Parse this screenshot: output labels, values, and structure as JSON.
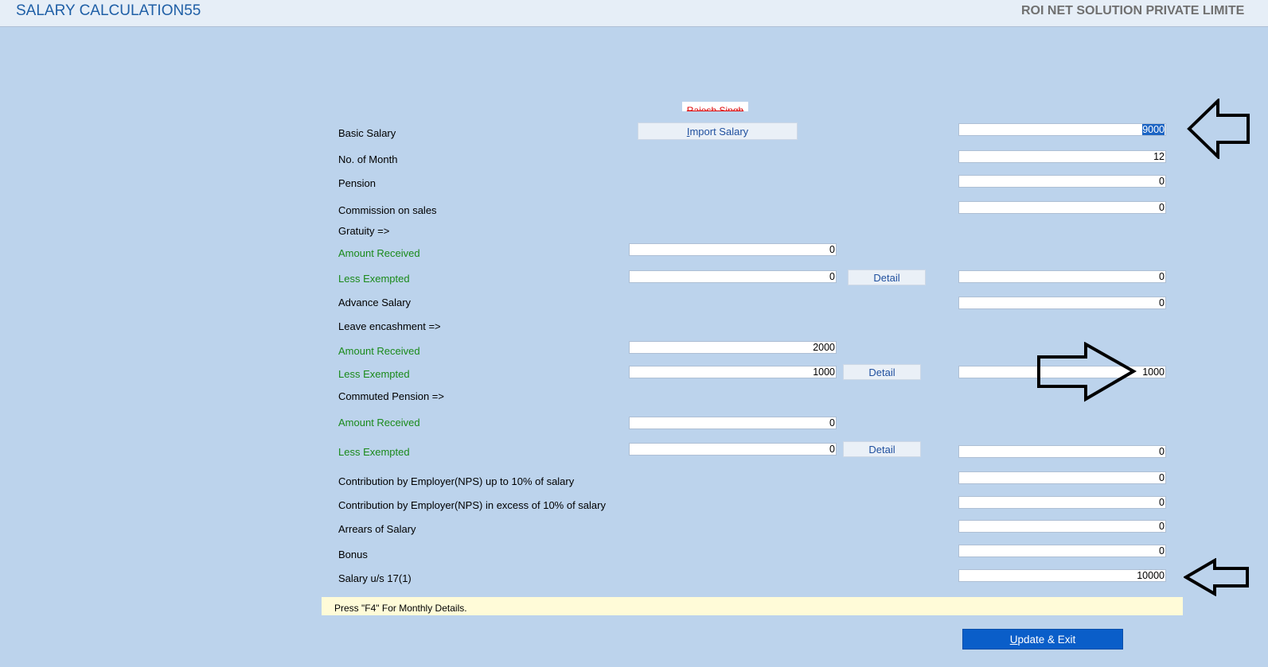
{
  "window": {
    "title": "SALARY CALCULATION55",
    "company": "ROI NET SOLUTION PRIVATE LIMITE"
  },
  "employee_name": "Rajesh Singh",
  "buttons": {
    "import_salary": "mport Salary",
    "import_salary_hotkey": "I",
    "detail": "Detail",
    "update_exit": "pdate & Exit",
    "update_exit_hotkey": "U"
  },
  "rows": {
    "basic_salary": {
      "label": "Basic Salary",
      "value": "9000"
    },
    "no_of_month": {
      "label": "No. of Month",
      "value": "12"
    },
    "pension": {
      "label": "Pension",
      "value": "0"
    },
    "commission": {
      "label": "Commission on sales",
      "value": "0"
    },
    "gratuity": {
      "label": "Gratuity =>",
      "amount_received_label": "Amount Received",
      "amount_received": "0",
      "less_exempted_label": "Less Exempted",
      "less_exempted": "0",
      "net": "0"
    },
    "advance_salary": {
      "label": "Advance Salary",
      "value": "0"
    },
    "leave_encashment": {
      "label": "Leave encashment =>",
      "amount_received_label": "Amount Received",
      "amount_received": "2000",
      "less_exempted_label": "Less Exempted",
      "less_exempted": "1000",
      "net": "1000"
    },
    "commuted_pension": {
      "label": "Commuted Pension =>",
      "amount_received_label": "Amount Received",
      "amount_received": "0",
      "less_exempted_label": "Less Exempted",
      "less_exempted": "0",
      "net": "0"
    },
    "nps_upto_10": {
      "label": "Contribution by Employer(NPS) up to 10% of salary",
      "value": "0"
    },
    "nps_excess_10": {
      "label": "Contribution by Employer(NPS) in excess of 10% of salary",
      "value": "0"
    },
    "arrears": {
      "label": "Arrears of Salary",
      "value": "0"
    },
    "bonus": {
      "label": "Bonus",
      "value": "0"
    },
    "salary_17_1": {
      "label": "Salary u/s 17(1)",
      "value": "10000"
    }
  },
  "hint": "Press \"F4\" For Monthly Details.",
  "colors": {
    "background": "#bcd3ec",
    "title": "#1f5fa6",
    "green_label": "#1a8a1a",
    "primary_button": "#0a5ec9",
    "hint_bar": "#fffbd8"
  }
}
